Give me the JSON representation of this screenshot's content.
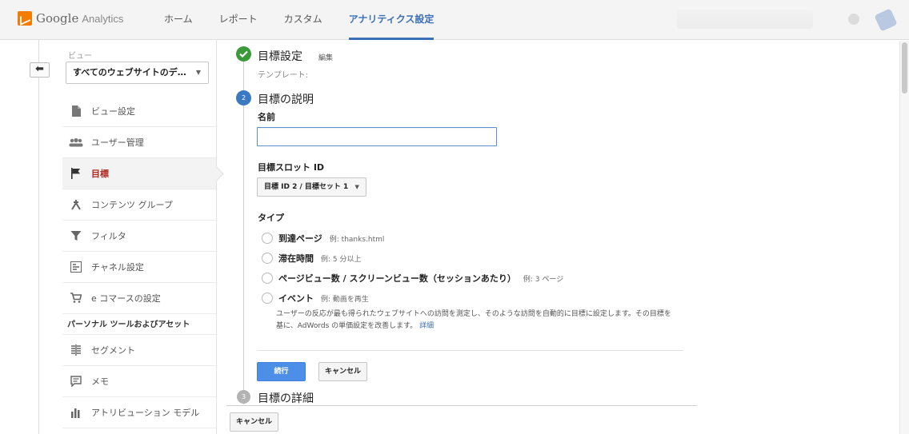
{
  "brand": {
    "google": "Google",
    "analytics": "Analytics"
  },
  "nav": {
    "home": "ホーム",
    "report": "レポート",
    "custom": "カスタム",
    "admin": "アナリティクス設定"
  },
  "sidebar": {
    "view_label": "ビュー",
    "view_value": "すべてのウェブサイトのデ…",
    "items": [
      {
        "label": "ビュー設定",
        "icon": "document-icon"
      },
      {
        "label": "ユーザー管理",
        "icon": "users-icon"
      },
      {
        "label": "目標",
        "icon": "flag-icon"
      },
      {
        "label": "コンテンツ グループ",
        "icon": "content-group-icon"
      },
      {
        "label": "フィルタ",
        "icon": "filter-icon"
      },
      {
        "label": "チャネル設定",
        "icon": "channel-icon"
      },
      {
        "label": "e コマースの設定",
        "icon": "cart-icon"
      }
    ],
    "section_title": "パーソナル ツールおよびアセット",
    "items2": [
      {
        "label": "セグメント",
        "icon": "segment-icon"
      },
      {
        "label": "メモ",
        "icon": "memo-icon"
      },
      {
        "label": "アトリビューション モデル",
        "icon": "attribution-icon"
      }
    ]
  },
  "steps": {
    "step1": {
      "title": "目標設定",
      "edit": "編集",
      "template_label": "テンプレート:"
    },
    "step2": {
      "num": "2",
      "title": "目標の説明",
      "name_label": "名前",
      "name_value": "",
      "slot_label": "目標スロット ID",
      "slot_value": "目標 ID 2 / 目標セット 1",
      "type_label": "タイプ",
      "types": [
        {
          "label": "到達ページ",
          "example": "例: thanks.html"
        },
        {
          "label": "滞在時間",
          "example": "例: 5 分以上"
        },
        {
          "label": "ページビュー数 / スクリーンビュー数（セッションあたり）",
          "example": "例: 3 ページ"
        },
        {
          "label": "イベント",
          "example": "例: 動画を再生"
        }
      ],
      "description_line1": "ユーザーの反応が最も得られたウェブサイトへの訪問を測定し、そのような訪問を自動的に目標に設定します。その目標を",
      "description_line2": "基に、AdWords の単価設定を改善します。",
      "detail_link": "詳細",
      "continue": "続行",
      "cancel": "キャンセル"
    },
    "step3": {
      "num": "3",
      "title": "目標の詳細"
    }
  },
  "footer": {
    "cancel": "キャンセル"
  },
  "colors": {
    "accent": "#3b6fb6",
    "step_done": "#3a9a3a",
    "step_active": "#3b79c3",
    "step_pending": "#b3b3b3",
    "active_item": "#b3261e"
  }
}
